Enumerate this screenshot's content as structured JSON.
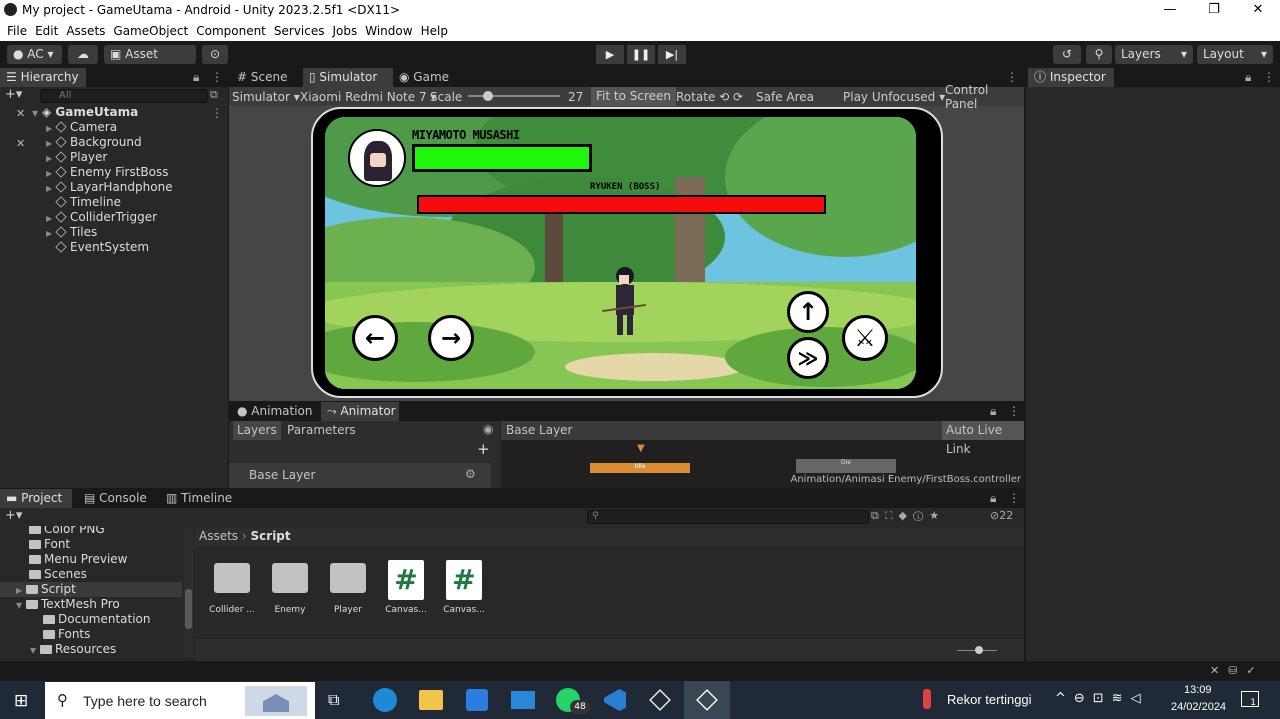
{
  "window": {
    "title": "My project - GameUtama - Android - Unity 2023.2.5f1 <DX11>"
  },
  "menu": [
    "File",
    "Edit",
    "Assets",
    "GameObject",
    "Component",
    "Services",
    "Jobs",
    "Window",
    "Help"
  ],
  "toolbar": {
    "account": "AC",
    "asset_store": "Asset Store",
    "layers": "Layers",
    "layout": "Layout"
  },
  "hierarchy": {
    "tab": "Hierarchy",
    "search_placeholder": "All",
    "root": "GameUtama",
    "items": [
      "Camera",
      "Background",
      "Player",
      "Enemy FirstBoss",
      "LayarHandphone",
      "Timeline",
      "ColliderTrigger",
      "Tiles",
      "EventSystem"
    ]
  },
  "scene_tabs": {
    "scene": "Scene",
    "simulator": "Simulator",
    "game": "Game"
  },
  "simulator_bar": {
    "mode": "Simulator",
    "device": "Xiaomi Redmi Note 7",
    "scale_label": "Scale",
    "scale_value": "27",
    "fit": "Fit to Screen",
    "rotate": "Rotate",
    "safe_area": "Safe Area",
    "play_mode": "Play Unfocused",
    "control_panel": "Control Panel"
  },
  "game": {
    "player_name": "MIYAMOTO MUSASHI",
    "boss_name": "RYUKEN (BOSS)",
    "player_health": 1.0,
    "boss_health": 1.0
  },
  "inspector": {
    "tab": "Inspector"
  },
  "animator": {
    "tab_animation": "Animation",
    "tab_animator": "Animator",
    "layers_tab": "Layers",
    "params_tab": "Parameters",
    "breadcrumb": "Base Layer",
    "auto_live": "Auto Live Link",
    "layer_name": "Base Layer",
    "state_idle": "Idle",
    "state_die": "Die",
    "controller_path": "Animation/Animasi Enemy/FirstBoss.controller"
  },
  "project": {
    "tab_project": "Project",
    "tab_console": "Console",
    "tab_timeline": "Timeline",
    "tree": [
      "Color PNG",
      "Font",
      "Menu Preview",
      "Scenes",
      "Script",
      "TextMesh Pro",
      "Documentation",
      "Fonts",
      "Resources"
    ],
    "breadcrumb_root": "Assets",
    "breadcrumb_current": "Script",
    "hidden_count": "22",
    "assets": [
      {
        "name": "Collider ...",
        "kind": "folder"
      },
      {
        "name": "Enemy",
        "kind": "folder"
      },
      {
        "name": "Player",
        "kind": "folder"
      },
      {
        "name": "Canvas...",
        "kind": "script"
      },
      {
        "name": "Canvas...",
        "kind": "script"
      }
    ]
  },
  "taskbar": {
    "search_placeholder": "Type here to search",
    "whatsapp_badge": "48",
    "weather": "Rekor tertinggi",
    "time": "13:09",
    "date": "24/02/2024",
    "notifications": "1"
  }
}
